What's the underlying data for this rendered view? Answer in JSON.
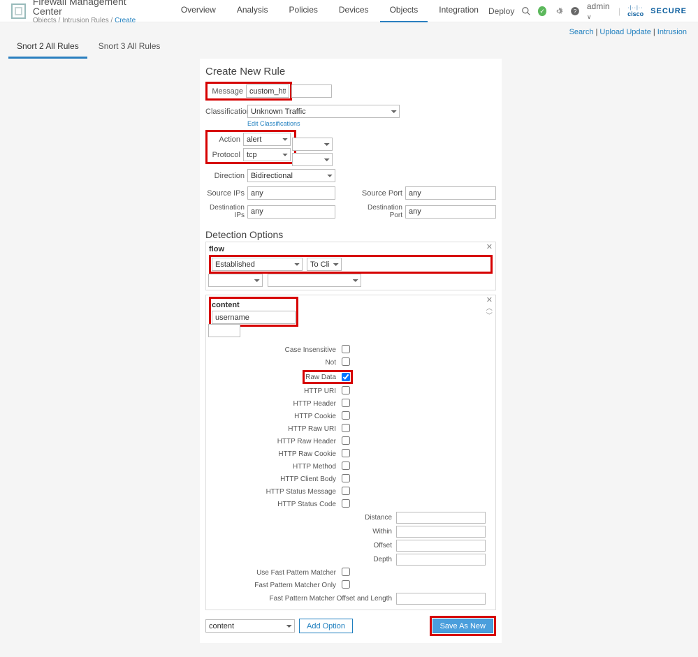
{
  "header": {
    "title": "Firewall Management Center",
    "breadcrumbs": {
      "a": "Objects",
      "b": "Intrusion Rules",
      "c": "Create"
    },
    "tabs": [
      "Overview",
      "Analysis",
      "Policies",
      "Devices",
      "Objects",
      "Integration"
    ],
    "active_tab": 4,
    "deploy": "Deploy",
    "admin": "admin",
    "brand_a": "cisco",
    "brand_b": "SECURE",
    "links": {
      "search": "Search",
      "upload": "Upload Update",
      "intrusion": "Intrusion"
    }
  },
  "subtabs": {
    "items": [
      "Snort 2 All Rules",
      "Snort 3 All Rules"
    ],
    "active": 0
  },
  "form": {
    "title": "Create New Rule",
    "message": {
      "label": "Message",
      "value": "custom_http_sig"
    },
    "classification": {
      "label": "Classification",
      "value": "Unknown Traffic",
      "edit": "Edit Classifications"
    },
    "action": {
      "label": "Action",
      "value": "alert"
    },
    "protocol": {
      "label": "Protocol",
      "value": "tcp"
    },
    "direction": {
      "label": "Direction",
      "value": "Bidirectional"
    },
    "source_ips": {
      "label": "Source IPs",
      "value": "any"
    },
    "dest_ips": {
      "label": "Destination IPs",
      "value": "any"
    },
    "source_port": {
      "label": "Source Port",
      "value": "any"
    },
    "dest_port": {
      "label": "Destination Port",
      "value": "any"
    },
    "detect_title": "Detection Options",
    "flow": {
      "title": "flow",
      "state": "Established",
      "dir": "To Client"
    },
    "content": {
      "title": "content",
      "value": "username",
      "opts": [
        {
          "label": "Case Insensitive",
          "type": "cb",
          "checked": false
        },
        {
          "label": "Not",
          "type": "cb",
          "checked": false
        },
        {
          "label": "Raw Data",
          "type": "cb",
          "checked": true,
          "hl": true
        },
        {
          "label": "HTTP URI",
          "type": "cb",
          "checked": false
        },
        {
          "label": "HTTP Header",
          "type": "cb",
          "checked": false
        },
        {
          "label": "HTTP Cookie",
          "type": "cb",
          "checked": false
        },
        {
          "label": "HTTP Raw URI",
          "type": "cb",
          "checked": false
        },
        {
          "label": "HTTP Raw Header",
          "type": "cb",
          "checked": false
        },
        {
          "label": "HTTP Raw Cookie",
          "type": "cb",
          "checked": false
        },
        {
          "label": "HTTP Method",
          "type": "cb",
          "checked": false
        },
        {
          "label": "HTTP Client Body",
          "type": "cb",
          "checked": false
        },
        {
          "label": "HTTP Status Message",
          "type": "cb",
          "checked": false
        },
        {
          "label": "HTTP Status Code",
          "type": "cb",
          "checked": false
        },
        {
          "label": "Distance",
          "type": "in"
        },
        {
          "label": "Within",
          "type": "in"
        },
        {
          "label": "Offset",
          "type": "in"
        },
        {
          "label": "Depth",
          "type": "in"
        },
        {
          "label": "Use Fast Pattern Matcher",
          "type": "cb",
          "checked": false
        },
        {
          "label": "Fast Pattern Matcher Only",
          "type": "cb",
          "checked": false
        },
        {
          "label": "Fast Pattern Matcher Offset and Length",
          "type": "in"
        }
      ]
    },
    "add_sel": "content",
    "add_btn": "Add Option",
    "save_btn": "Save As New"
  }
}
